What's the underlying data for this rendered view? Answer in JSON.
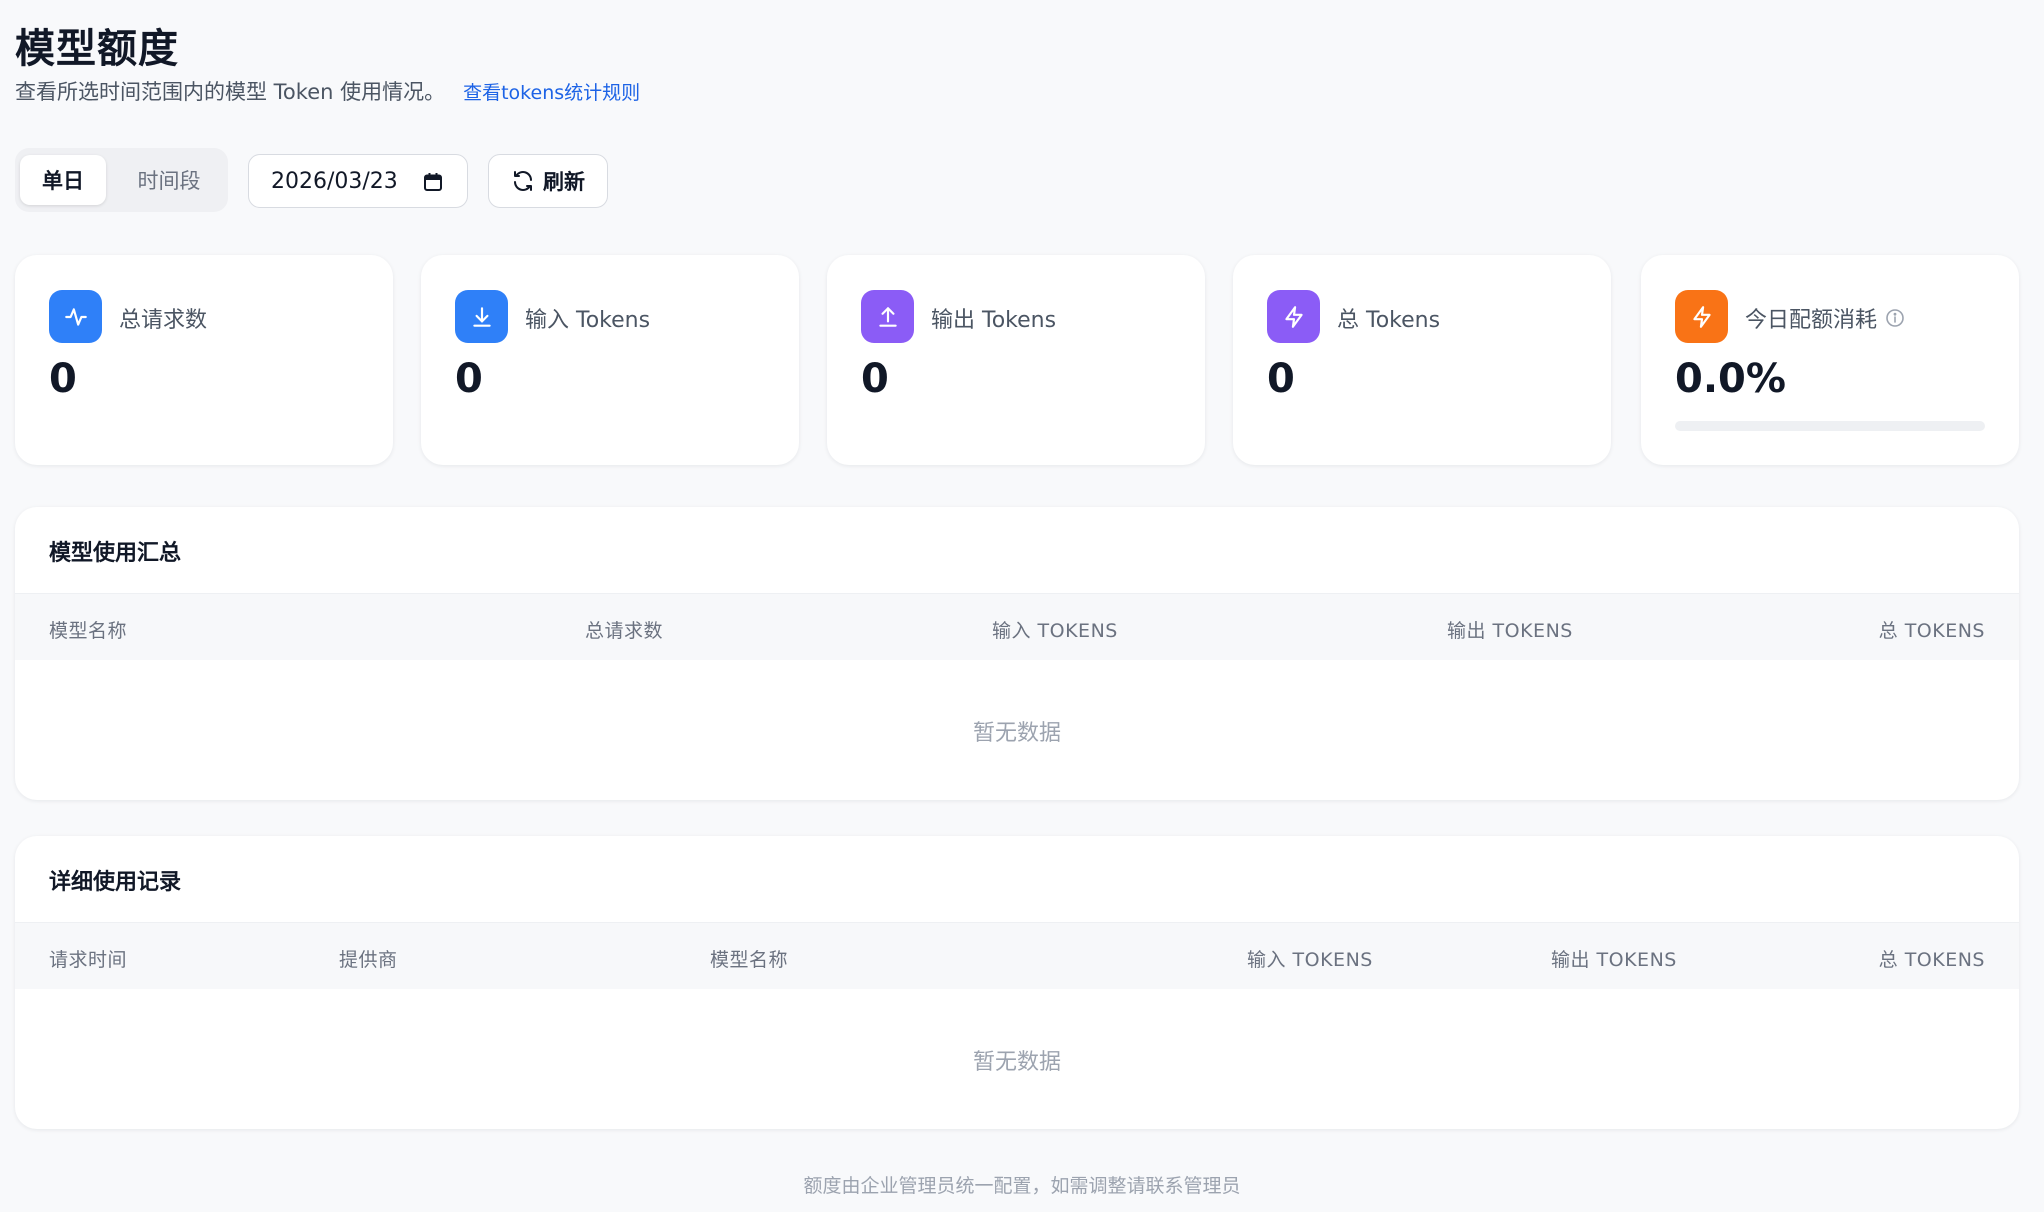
{
  "header": {
    "title": "模型额度",
    "subtitle": "查看所选时间范围内的模型 Token 使用情况。",
    "rules_link": "查看tokens统计规则"
  },
  "controls": {
    "mode_tabs": [
      "单日",
      "时间段"
    ],
    "active_mode": "单日",
    "date_value": "2026/03/23",
    "refresh_label": "刷新"
  },
  "stats": [
    {
      "label": "总请求数",
      "value": "0",
      "icon": "activity-icon",
      "color": "#2f80f8"
    },
    {
      "label": "输入 Tokens",
      "value": "0",
      "icon": "download-icon",
      "color": "#2f80f8"
    },
    {
      "label": "输出 Tokens",
      "value": "0",
      "icon": "upload-icon",
      "color": "#8b5cf6"
    },
    {
      "label": "总 Tokens",
      "value": "0",
      "icon": "lightning-icon",
      "color": "#8b5cf6"
    },
    {
      "label": "今日配额消耗",
      "value": "0.0%",
      "icon": "lightning-icon",
      "color": "#f97316",
      "progress": 0.0
    }
  ],
  "summary": {
    "title": "模型使用汇总",
    "columns": [
      "模型名称",
      "总请求数",
      "输入 TOKENS",
      "输出 TOKENS",
      "总 TOKENS"
    ],
    "empty_text": "暂无数据"
  },
  "details": {
    "title": "详细使用记录",
    "columns": [
      "请求时间",
      "提供商",
      "模型名称",
      "输入 TOKENS",
      "输出 TOKENS",
      "总 TOKENS"
    ],
    "empty_text": "暂无数据"
  },
  "footer": {
    "note": "额度由企业管理员统一配置，如需调整请联系管理员"
  }
}
